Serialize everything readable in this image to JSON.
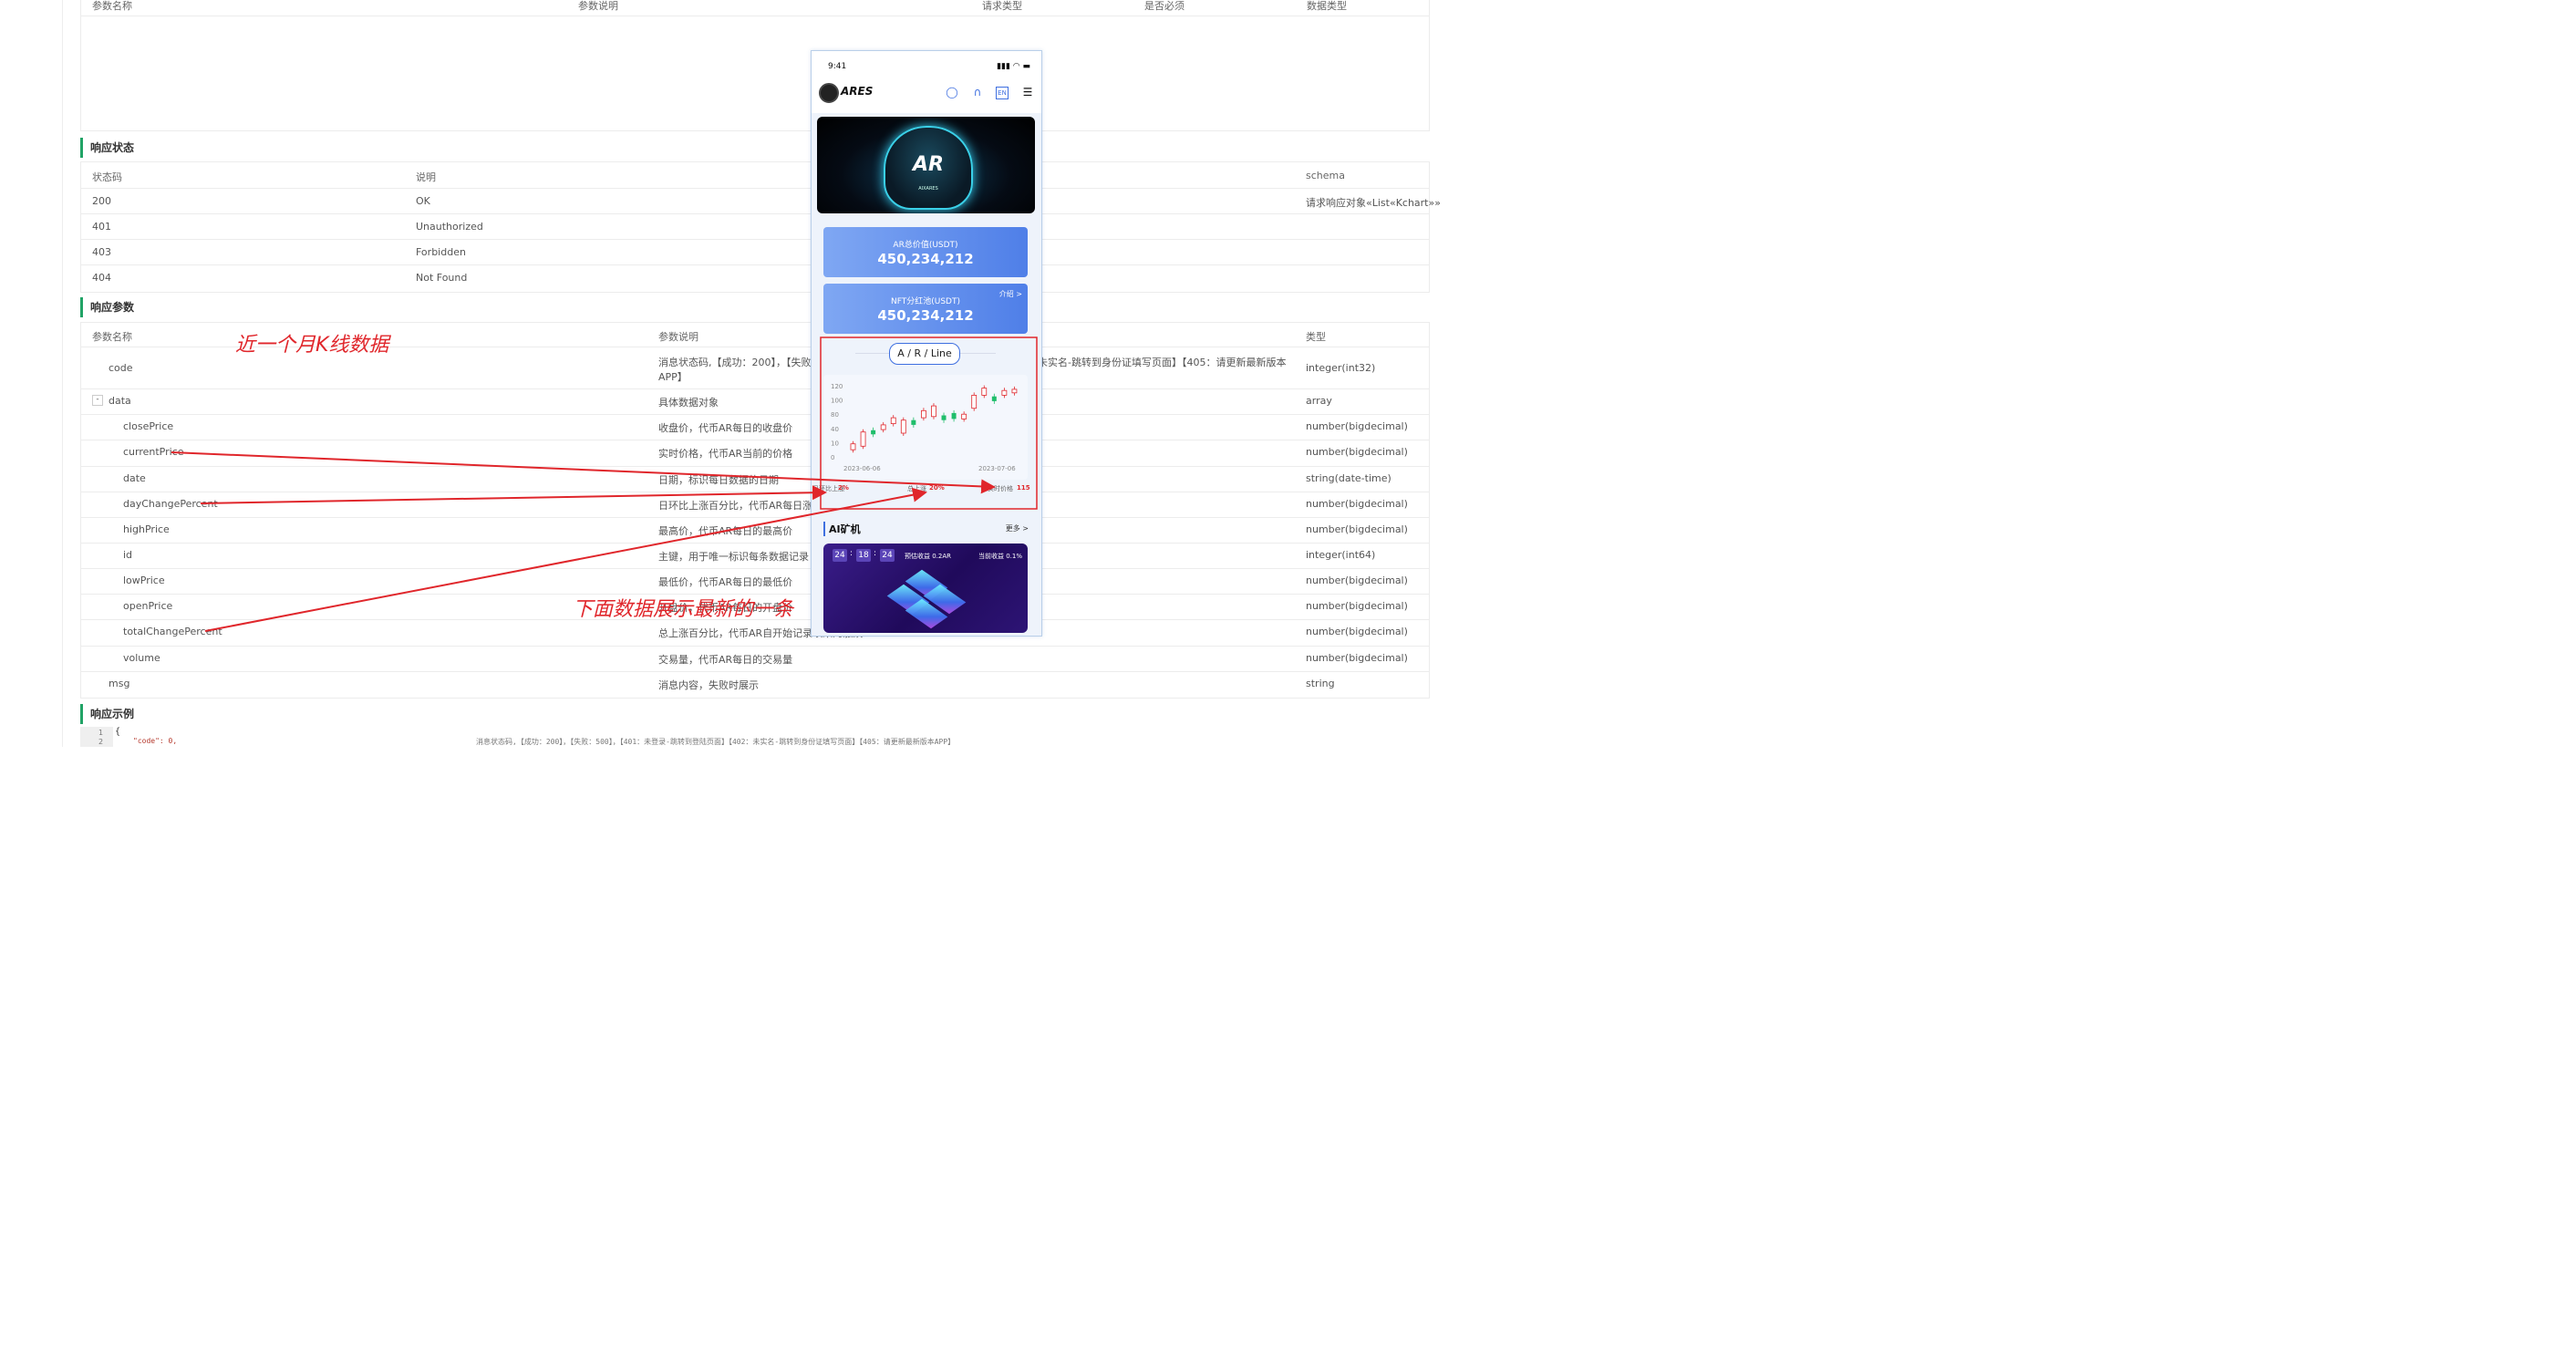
{
  "request_params_table": {
    "headers": [
      "参数名称",
      "参数说明",
      "请求类型",
      "是否必须",
      "数据类型"
    ]
  },
  "response_status": {
    "title": "响应状态",
    "headers": [
      "状态码",
      "说明",
      "schema"
    ],
    "rows": [
      {
        "code": "200",
        "desc": "OK",
        "schema": "请求响应对象«List«Kchart»»"
      },
      {
        "code": "401",
        "desc": "Unauthorized",
        "schema": ""
      },
      {
        "code": "403",
        "desc": "Forbidden",
        "schema": ""
      },
      {
        "code": "404",
        "desc": "Not Found",
        "schema": ""
      }
    ]
  },
  "response_params": {
    "title": "响应参数",
    "headers": [
      "参数名称",
      "参数说明",
      "类型"
    ],
    "rows": [
      {
        "name": "code",
        "desc": "消息状态码,【成功：200】，【失败",
        "desc_right": "未实名-跳转到身份证填写页面】【405：请更新最新版本",
        "desc_line2": "APP】",
        "type": "integer(int32)"
      },
      {
        "name": "data",
        "toggle": "-",
        "desc": "具体数据对象",
        "type": "array"
      },
      {
        "name": "closePrice",
        "desc": "收盘价，代币AR每日的收盘价",
        "type": "number(bigdecimal)"
      },
      {
        "name": "currentPrice",
        "desc": "实时价格，代币AR当前的价格",
        "type": "number(bigdecimal)"
      },
      {
        "name": "date",
        "desc": "日期，标识每日数据的日期",
        "type": "string(date-time)"
      },
      {
        "name": "dayChangePercent",
        "desc": "日环比上涨百分比，代币AR每日涨跌",
        "type": "number(bigdecimal)"
      },
      {
        "name": "highPrice",
        "desc": "最高价，代币AR每日的最高价",
        "type": "number(bigdecimal)"
      },
      {
        "name": "id",
        "desc": "主键，用于唯一标识每条数据记录",
        "type": "integer(int64)"
      },
      {
        "name": "lowPrice",
        "desc": "最低价，代币AR每日的最低价",
        "type": "number(bigdecimal)"
      },
      {
        "name": "openPrice",
        "desc": "开盘价，代币AR每日的开盘价",
        "type": "number(bigdecimal)"
      },
      {
        "name": "totalChangePercent",
        "desc": "总上涨百分比，代币AR自开始记录以来的涨跌",
        "type": "number(bigdecimal)"
      },
      {
        "name": "volume",
        "desc": "交易量，代币AR每日的交易量",
        "type": "number(bigdecimal)"
      },
      {
        "name": "msg",
        "desc": "消息内容，失败时展示",
        "type": "string"
      }
    ]
  },
  "response_example": {
    "title": "响应示例",
    "line_numbers": [
      "1",
      "2"
    ],
    "line1": "{",
    "line2": "\"code\": 0,",
    "comment": "消息状态码,【成功：200】，【失败：500】，【401：未登录-跳转到登陆页面】【402：未实名-跳转到身份证填写页面】【405：请更新最新版本APP】"
  },
  "annotations": {
    "top": "近一个月K线数据",
    "bottom": "下面数据展示最新的一条"
  },
  "phone": {
    "time": "9:41",
    "brand": "ARES",
    "banner_logo": "AR",
    "banner_sub": "AIXARES",
    "card1_label": "AR总价值(USDT)",
    "card1_value": "450,234,212",
    "card2_label": "NFT分红池(USDT)",
    "card2_value": "450,234,212",
    "card2_link": "介绍 >",
    "chart_tab": "A / R / Line",
    "stat1_label": "日环比上涨",
    "stat1_value": "2%",
    "stat2_label": "总上涨",
    "stat2_value": "20%",
    "stat3_label": "实时价格",
    "stat3_value": "115",
    "ai_title": "AI矿机",
    "ai_more": "更多 >",
    "timer": [
      "24",
      "18",
      "24"
    ],
    "ai_expected": "预估收益 0.2AR",
    "ai_current": "当前收益 0.1%"
  },
  "chart_data": {
    "type": "candlestick",
    "y_ticks": [
      "120",
      "100",
      "80",
      "40",
      "10",
      "0"
    ],
    "x_labels": [
      "2023-06-06",
      "2023-07-06"
    ],
    "candles": [
      {
        "open": 12,
        "close": 22,
        "dir": "up"
      },
      {
        "open": 18,
        "close": 42,
        "dir": "up"
      },
      {
        "open": 45,
        "close": 38,
        "dir": "down"
      },
      {
        "open": 46,
        "close": 54,
        "dir": "up"
      },
      {
        "open": 56,
        "close": 66,
        "dir": "up"
      },
      {
        "open": 62,
        "close": 40,
        "dir": "up"
      },
      {
        "open": 54,
        "close": 62,
        "dir": "down"
      },
      {
        "open": 66,
        "close": 78,
        "dir": "up"
      },
      {
        "open": 68,
        "close": 86,
        "dir": "up"
      },
      {
        "open": 70,
        "close": 62,
        "dir": "down"
      },
      {
        "open": 64,
        "close": 74,
        "dir": "down"
      },
      {
        "open": 64,
        "close": 72,
        "dir": "up"
      },
      {
        "open": 82,
        "close": 104,
        "dir": "up"
      },
      {
        "open": 104,
        "close": 116,
        "dir": "up"
      },
      {
        "open": 102,
        "close": 94,
        "dir": "down"
      },
      {
        "open": 104,
        "close": 112,
        "dir": "up"
      },
      {
        "open": 108,
        "close": 114,
        "dir": "up"
      }
    ],
    "ylim": [
      0,
      120
    ],
    "colors": {
      "up": "#e0262b",
      "down": "#1fbe6b"
    }
  }
}
